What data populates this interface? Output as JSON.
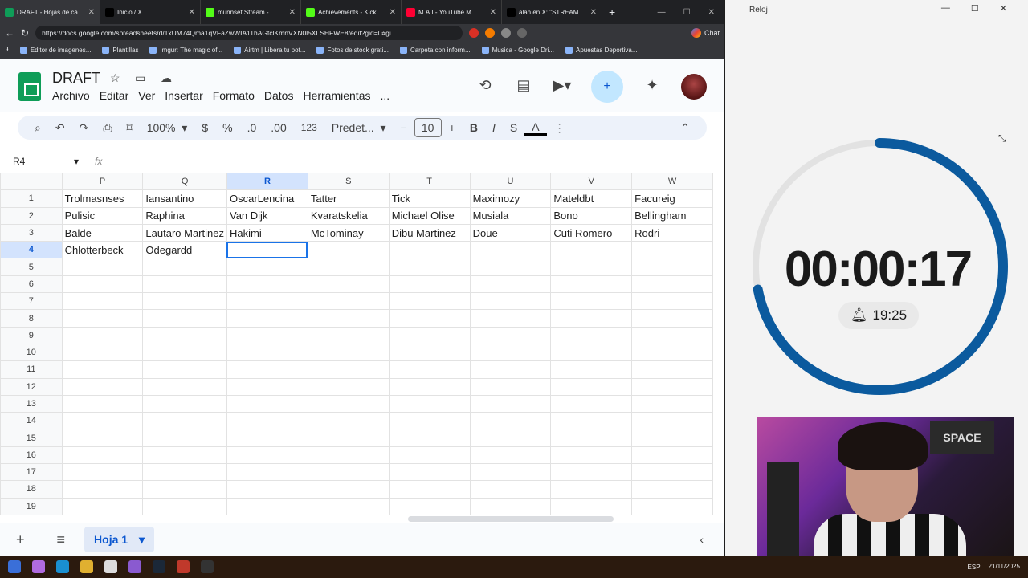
{
  "browser": {
    "tabs": [
      {
        "title": "DRAFT - Hojas de cálcul",
        "color": "#0f9d58",
        "active": true
      },
      {
        "title": "Inicio / X",
        "color": "#000000",
        "active": false
      },
      {
        "title": "munnset Stream -",
        "color": "#53fc18",
        "active": false
      },
      {
        "title": "Achievements - Kick Da",
        "color": "#53fc18",
        "active": false
      },
      {
        "title": "M.A.I - YouTube M",
        "color": "#ff0033",
        "active": false
      },
      {
        "title": "alan en X: \"STREAMER",
        "color": "#000000",
        "active": false
      }
    ],
    "url": "https://docs.google.com/spreadsheets/d/1xUM74Qma1qVFaZwWIA11hAGtclKmnVXN0l5XLSHFWE8/edit?gid=0#gi...",
    "chat_label": "Chat",
    "bookmarks": [
      "Editor de imagenes...",
      "Plantillas",
      "Imgur: The magic of...",
      "Airtm | Libera tu pot...",
      "Fotos de stock grati...",
      "Carpeta con inform...",
      "Musica - Google Dri...",
      "Apuestas Deportiva..."
    ]
  },
  "sheets": {
    "title": "DRAFT",
    "menu": [
      "Archivo",
      "Editar",
      "Ver",
      "Insertar",
      "Formato",
      "Datos",
      "Herramientas",
      "..."
    ],
    "toolbar": {
      "zoom": "100%",
      "currency": "$",
      "percent": "%",
      "dec_less": ".0",
      "dec_more": ".00",
      "number_format": "123",
      "font": "Predet...",
      "font_size": "10",
      "bold": "B",
      "italic": "I",
      "strike": "S",
      "text_color": "A"
    },
    "name_box": "R4",
    "fx": "fx",
    "columns": [
      "P",
      "Q",
      "R",
      "S",
      "T",
      "U",
      "V",
      "W"
    ],
    "rows": [
      [
        "Trolmasnses",
        "Iansantino",
        "OscarLencina",
        "Tatter",
        "Tick",
        "Maximozy",
        "Mateldbt",
        "Facureig"
      ],
      [
        "Pulisic",
        "Raphina",
        "Van Dijk",
        "Kvaratskelia",
        "Michael Olise",
        "Musiala",
        "Bono",
        "Bellingham"
      ],
      [
        "Balde",
        "Lautaro Martinez",
        "Hakimi",
        "McTominay",
        "Dibu Martinez",
        "Doue",
        "Cuti Romero",
        "Rodri"
      ],
      [
        "Chlotterbeck",
        "Odegardd",
        "",
        "",
        "",
        "",
        "",
        ""
      ]
    ],
    "row_numbers": [
      "1",
      "2",
      "3",
      "4",
      "5",
      "6",
      "7",
      "8",
      "9",
      "10",
      "11",
      "12",
      "13",
      "14",
      "15",
      "16",
      "17",
      "18",
      "19"
    ],
    "sheet_tab": "Hoja 1"
  },
  "clock": {
    "app_name": "Reloj",
    "timer": "00:00:17",
    "alarm_time": "19:25",
    "accent": "#0b5a9e",
    "progress": 0.72
  },
  "taskbar": {
    "lang": "ESP",
    "date": "21/11/2025"
  }
}
